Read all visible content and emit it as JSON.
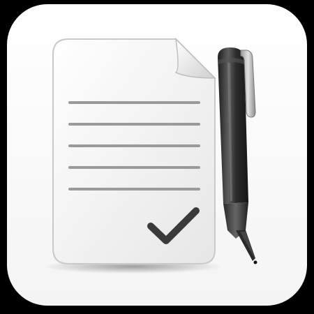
{
  "icon": {
    "name": "document-with-pen-app-icon",
    "colors": {
      "frame": "#000000",
      "tile": "#ffffff",
      "paper": "#f1f1f1",
      "paper_edge": "#c9c9c9",
      "lines": "#9a9a9a",
      "checkmark": "#3a3a3a",
      "pen_body": "#2b2b2b",
      "pen_highlight": "#6a6a6a"
    },
    "document": {
      "ruled_line_count": 5,
      "has_folded_corner": true,
      "has_checkmark": true
    },
    "pen": {
      "has_clip": true
    }
  }
}
